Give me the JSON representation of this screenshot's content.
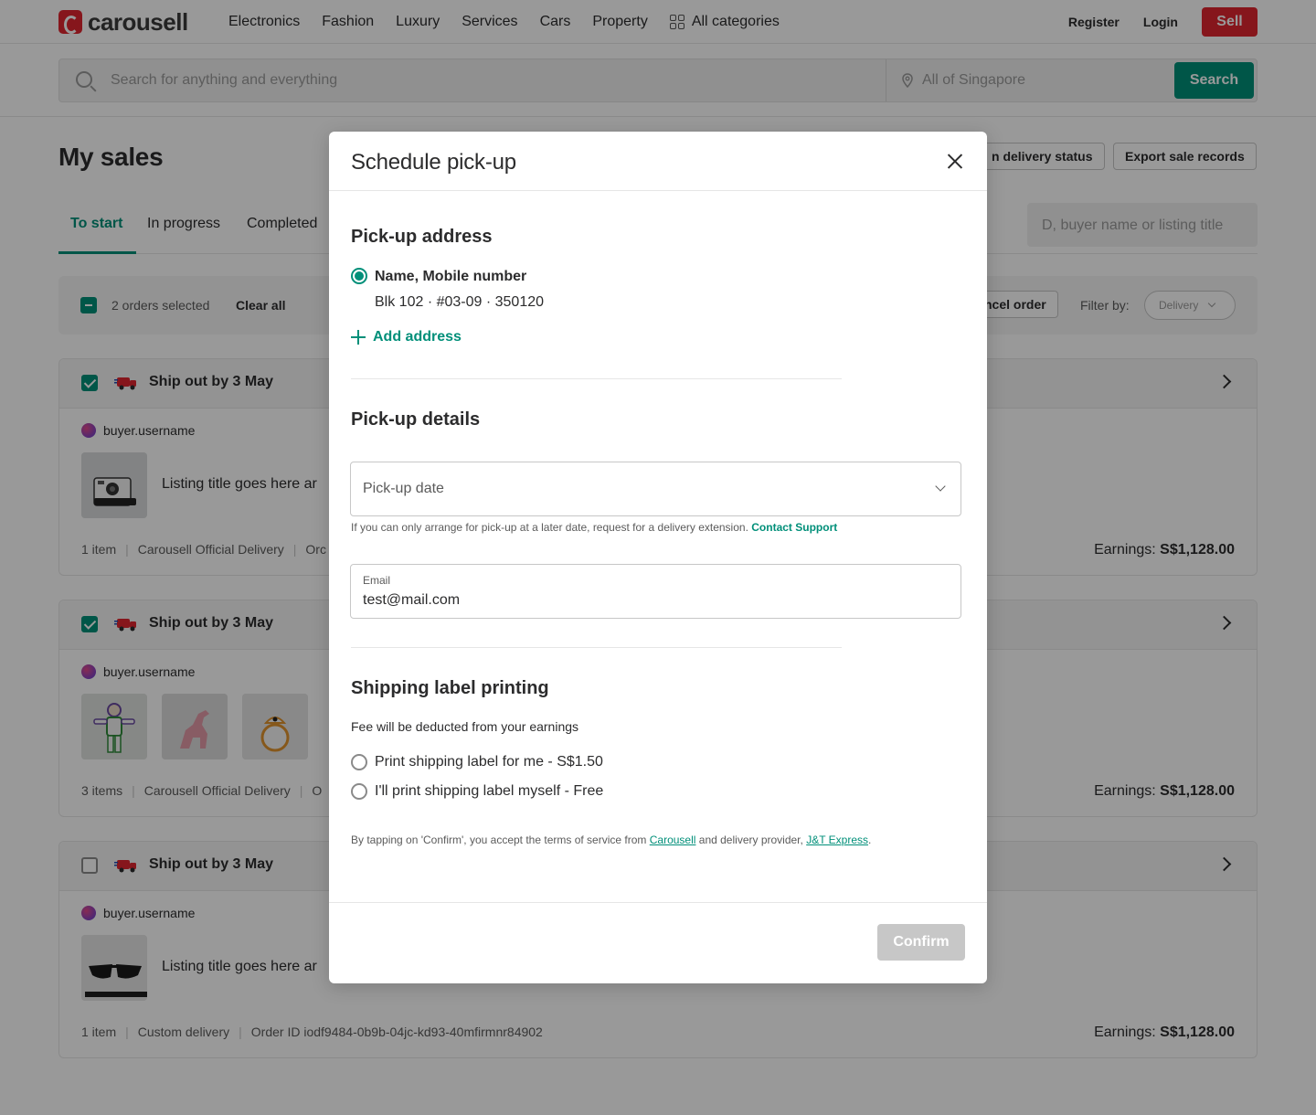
{
  "header": {
    "logo_text": "carousell",
    "nav": [
      "Electronics",
      "Fashion",
      "Luxury",
      "Services",
      "Cars",
      "Property",
      "All categories"
    ],
    "register": "Register",
    "login": "Login",
    "sell": "Sell"
  },
  "search": {
    "placeholder": "Search for anything and everything",
    "location_placeholder": "All of Singapore",
    "button": "Search"
  },
  "page": {
    "title": "My sales",
    "delivery_status_btn": "n delivery status",
    "export_btn": "Export sale records",
    "tabs": [
      "To start",
      "In progress",
      "Completed"
    ],
    "order_search_placeholder": "D, buyer name or listing title"
  },
  "toolbar": {
    "selected_text": "2 orders selected",
    "clear_all": "Clear all",
    "cancel_order": "ncel order",
    "filter_label": "Filter by:",
    "filter_value": "Delivery"
  },
  "orders": [
    {
      "checked": true,
      "ship_text": "Ship out by 3 May",
      "buyer": "buyer.username",
      "listing_title": "Listing title goes here ar",
      "meta": [
        "1 item",
        "Carousell Official Delivery",
        "Orc"
      ],
      "earnings_label": "Earnings:",
      "earnings_value": "S$1,128.00"
    },
    {
      "checked": true,
      "ship_text": "Ship out by 3 May",
      "buyer": "buyer.username",
      "listing_title": "",
      "meta": [
        "3 items",
        "Carousell Official Delivery",
        "O"
      ],
      "earnings_label": "Earnings:",
      "earnings_value": "S$1,128.00"
    },
    {
      "checked": false,
      "ship_text": "Ship out by 3 May",
      "buyer": "buyer.username",
      "listing_title": "Listing title goes here ar",
      "meta": [
        "1 item",
        "Custom delivery",
        "Order ID iodf9484-0b9b-04jc-kd93-40mfirmnr84902"
      ],
      "earnings_label": "Earnings:",
      "earnings_value": "S$1,128.00"
    }
  ],
  "modal": {
    "title": "Schedule pick-up",
    "address_section": "Pick-up address",
    "address_name": "Name,  Mobile number",
    "address_line": "Blk 102 ·  #03-09  · 350120",
    "add_address": "Add address",
    "details_section": "Pick-up details",
    "pickup_date_placeholder": "Pick-up date",
    "helper_text": "If you can only arrange for pick-up at a later date, request for a delivery extension.",
    "contact_support": "Contact Support",
    "email_label": "Email",
    "email_value": "test@mail.com",
    "label_section": "Shipping label printing",
    "fee_note": "Fee will be deducted from your earnings",
    "option_print_for_me": "Print shipping label for me - S$1.50",
    "option_print_myself": "I'll print shipping label myself - Free",
    "terms_prefix": "By tapping on 'Confirm', you accept the terms of service from",
    "terms_carousell": "Carousell",
    "terms_middle": "and delivery provider,",
    "terms_provider": "J&T Express",
    "terms_suffix": ".",
    "confirm": "Confirm"
  },
  "colors": {
    "brand_red": "#e0262f",
    "accent_green": "#008f79",
    "disabled_grey": "#c7c7c7"
  }
}
